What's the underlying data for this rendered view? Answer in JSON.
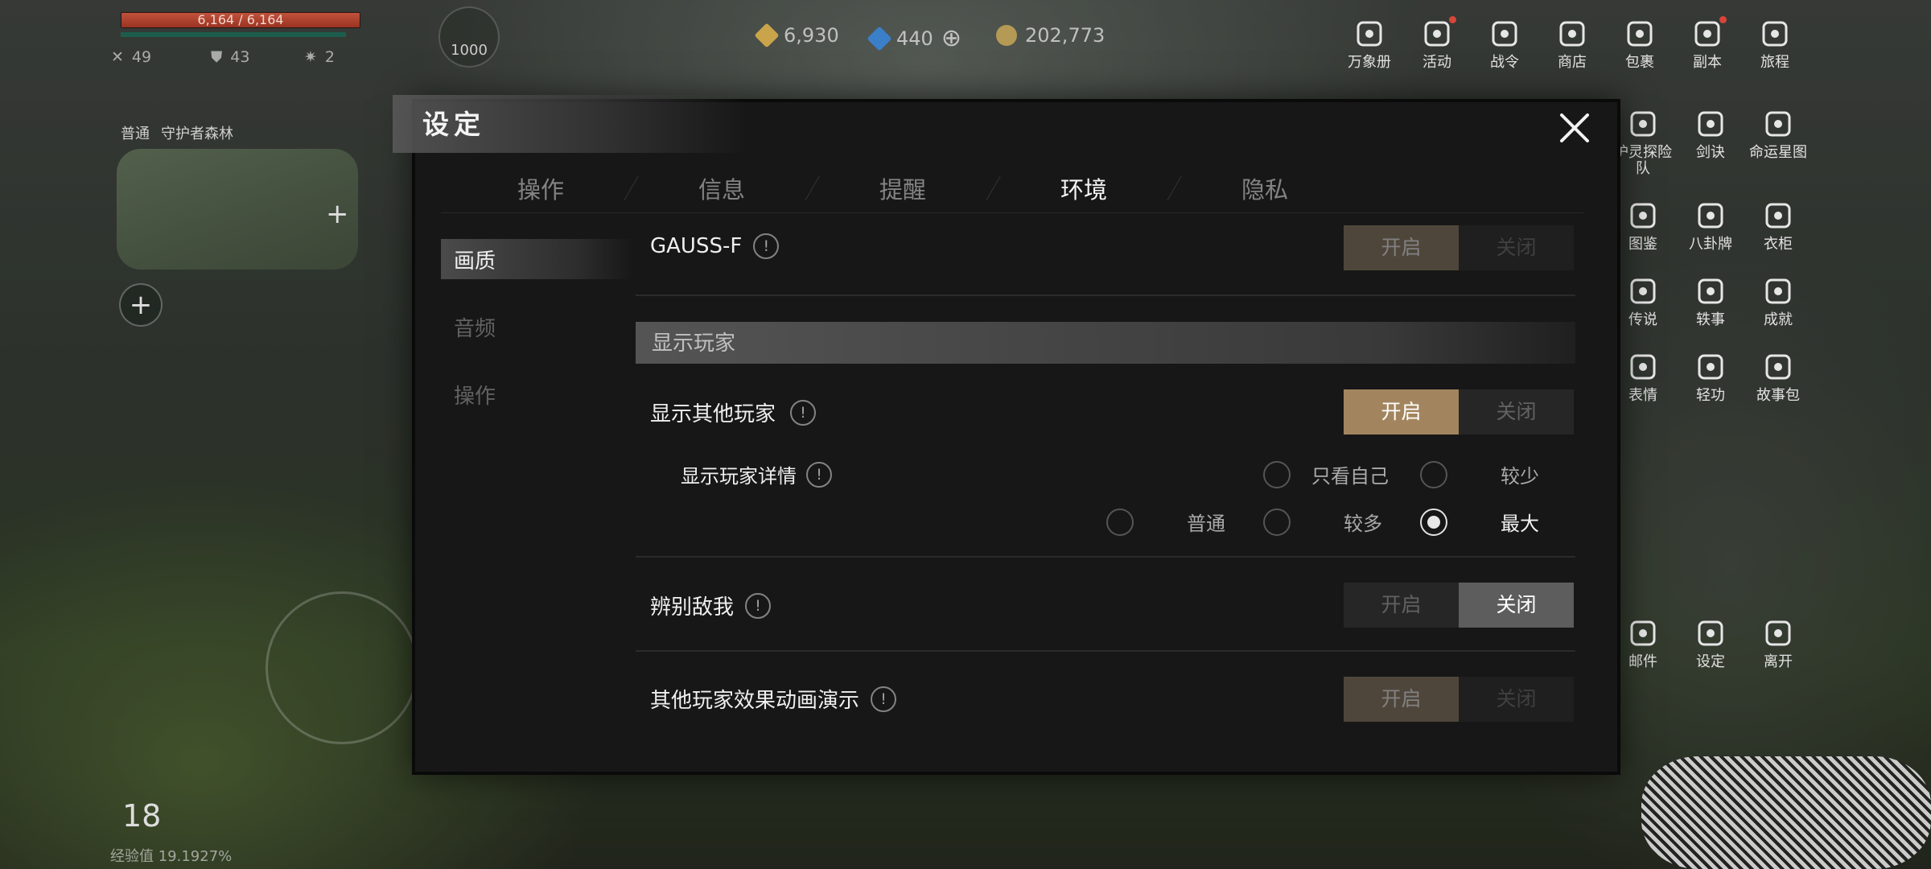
{
  "hud": {
    "hp_text": "6,164 / 6,164",
    "hp_fraction": 1.0,
    "stats": [
      "49",
      "43",
      "2"
    ],
    "avatar_value": "1000",
    "region_mode": "普通",
    "region_name": "守护者森林",
    "level": "18",
    "exp_text": "经验值 19.1927%"
  },
  "currency": [
    {
      "value": "6,930",
      "color": "#c9a44a"
    },
    {
      "value": "440",
      "color": "#3b7fc9"
    },
    {
      "value": "202,773",
      "color": "#b59a55"
    }
  ],
  "menu_top": [
    {
      "label": "万象册",
      "icon": "book-icon",
      "dot": false
    },
    {
      "label": "活动",
      "icon": "gift-icon",
      "dot": true
    },
    {
      "label": "战令",
      "icon": "calendar-icon",
      "dot": false
    },
    {
      "label": "商店",
      "icon": "shop-icon",
      "dot": false
    },
    {
      "label": "包裹",
      "icon": "bag-icon",
      "dot": false
    },
    {
      "label": "副本",
      "icon": "dungeon-icon",
      "dot": true
    },
    {
      "label": "旅程",
      "icon": "journey-icon",
      "dot": false
    }
  ],
  "menu_grid": [
    {
      "label": "护灵探险队",
      "icon": "spirit-team-icon"
    },
    {
      "label": "剑诀",
      "icon": "sword-art-icon"
    },
    {
      "label": "命运星图",
      "icon": "star-map-icon"
    },
    {
      "label": "图鉴",
      "icon": "codex-icon"
    },
    {
      "label": "八卦牌",
      "icon": "bagua-icon"
    },
    {
      "label": "衣柜",
      "icon": "wardrobe-icon"
    },
    {
      "label": "传说",
      "icon": "legend-icon"
    },
    {
      "label": "轶事",
      "icon": "anecdote-icon"
    },
    {
      "label": "成就",
      "icon": "achievement-icon"
    },
    {
      "label": "表情",
      "icon": "emote-icon"
    },
    {
      "label": "轻功",
      "icon": "lightness-skill-icon"
    },
    {
      "label": "故事包",
      "icon": "story-pack-icon"
    }
  ],
  "menu_bottom": [
    {
      "label": "邮件",
      "icon": "mail-icon"
    },
    {
      "label": "设定",
      "icon": "settings-gear-icon"
    },
    {
      "label": "离开",
      "icon": "exit-icon"
    }
  ],
  "dialog": {
    "title": "设定",
    "tabs": [
      "操作",
      "信息",
      "提醒",
      "环境",
      "隐私"
    ],
    "active_tab": "环境",
    "side_nav": [
      "画质",
      "音频",
      "操作"
    ],
    "active_side": "画质",
    "rows": {
      "gauss": {
        "label": "GAUSS-F",
        "on": "开启",
        "off": "关闭"
      },
      "section_title": "显示玩家",
      "show_others": {
        "label": "显示其他玩家",
        "on": "开启",
        "off": "关闭"
      },
      "player_detail": {
        "label": "显示玩家详情",
        "options": [
          "只看自己",
          "较少",
          "普通",
          "较多",
          "最大"
        ],
        "selected": "最大"
      },
      "enemy_id": {
        "label": "辨别敌我",
        "on": "开启",
        "off": "关闭"
      },
      "effects": {
        "label": "其他玩家效果动画演示",
        "on": "开启",
        "off": "关闭"
      }
    },
    "info_glyph": "!"
  }
}
